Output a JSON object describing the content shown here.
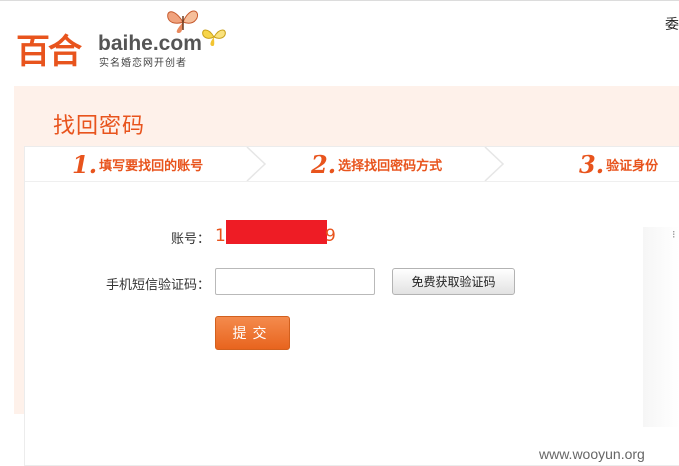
{
  "header": {
    "logo_cn": "百合",
    "logo_en": "baihe.com",
    "tagline": "实名婚恋网开创者",
    "right_text": "委"
  },
  "page": {
    "title": "找回密码"
  },
  "steps": [
    {
      "num": "1.",
      "label": "填写要找回的账号"
    },
    {
      "num": "2.",
      "label": "选择找回密码方式"
    },
    {
      "num": "3.",
      "label": "验证身份"
    }
  ],
  "form": {
    "account_label": "账号：",
    "account_prefix": "1",
    "account_suffix": "9",
    "code_label": "手机短信验证码：",
    "code_value": "",
    "sms_button": "免费获取验证码",
    "submit_button": "提交"
  },
  "watermark": "www.wooyun.org",
  "colors": {
    "accent": "#e8541d",
    "panel_bg": "#fef1ea",
    "redaction": "#ee1c25"
  }
}
